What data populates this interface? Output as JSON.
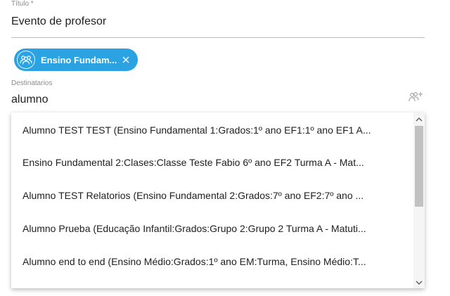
{
  "title_field": {
    "label": "Título *",
    "value": "Evento de profesor"
  },
  "chip": {
    "label": "Ensino Fundam...",
    "icon": "group-icon",
    "color": "#2ba3e2"
  },
  "recipients_field": {
    "label": "Destinatarios",
    "value": "alumno",
    "icon": "add-people-icon"
  },
  "dropdown": {
    "options": [
      "Alumno TEST TEST (Ensino Fundamental 1:Grados:1º ano EF1:1º ano EF1 A...",
      "Ensino Fundamental 2:Clases:Classe Teste Fabio 6º ano EF2 Turma A - Mat...",
      "Alumno TEST Relatorios (Ensino Fundamental 2:Grados:7º ano EF2:7º ano ...",
      "Alumno Prueba (Educação Infantil:Grados:Grupo 2:Grupo 2 Turma A - Matuti...",
      "Alumno end to end (Ensino Médio:Grados:1º ano EM:Turma, Ensino Médio:T..."
    ]
  }
}
